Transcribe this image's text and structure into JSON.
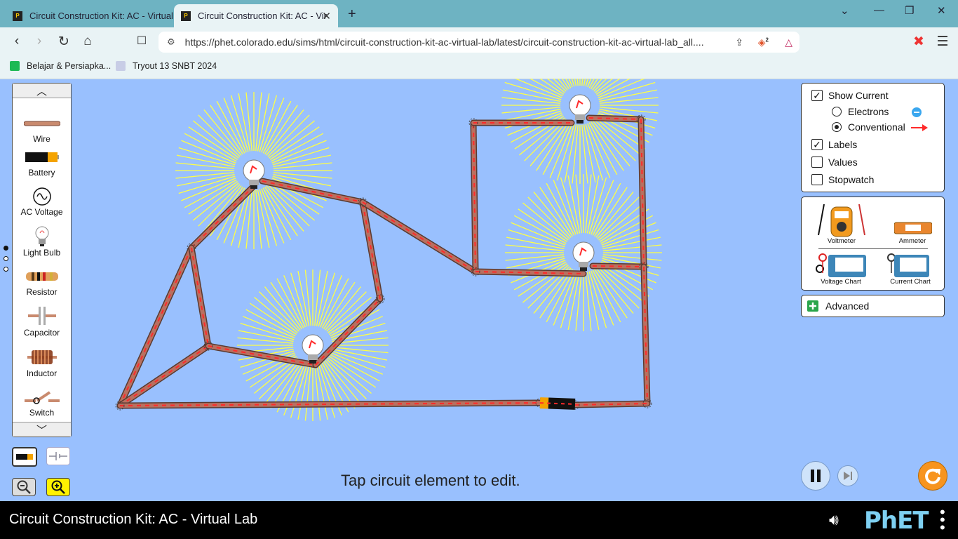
{
  "browser": {
    "tabs": [
      {
        "label": "Circuit Construction Kit: AC - Virtual"
      },
      {
        "label": "Circuit Construction Kit: AC - Vir"
      }
    ],
    "url": "https://phet.colorado.edu/sims/html/circuit-construction-kit-ac-virtual-lab/latest/circuit-construction-kit-ac-virtual-lab_all....",
    "bookmarks": [
      {
        "label": "Belajar & Persiapka..."
      },
      {
        "label": "Tryout 13 SNBT 2024"
      }
    ],
    "brave_badge": "2"
  },
  "toolbox": {
    "items": [
      {
        "label": "Wire",
        "icon": "wire-icon"
      },
      {
        "label": "Battery",
        "icon": "battery-icon"
      },
      {
        "label": "AC Voltage",
        "icon": "ac-voltage-icon"
      },
      {
        "label": "Light Bulb",
        "icon": "light-bulb-icon"
      },
      {
        "label": "Resistor",
        "icon": "resistor-icon"
      },
      {
        "label": "Capacitor",
        "icon": "capacitor-icon"
      },
      {
        "label": "Inductor",
        "icon": "inductor-icon"
      },
      {
        "label": "Switch",
        "icon": "switch-icon"
      }
    ]
  },
  "controls": {
    "show_current": {
      "label": "Show Current",
      "checked": true
    },
    "electrons": {
      "label": "Electrons",
      "selected": false
    },
    "conventional": {
      "label": "Conventional",
      "selected": true
    },
    "labels": {
      "label": "Labels",
      "checked": true
    },
    "values": {
      "label": "Values",
      "checked": false
    },
    "stopwatch": {
      "label": "Stopwatch",
      "checked": false
    }
  },
  "meters": {
    "voltmeter": "Voltmeter",
    "ammeter": "Ammeter",
    "voltage_chart": "Voltage Chart",
    "current_chart": "Current Chart"
  },
  "advanced": {
    "label": "Advanced"
  },
  "hint": "Tap circuit element to edit.",
  "footer": {
    "title": "Circuit Construction Kit: AC - Virtual Lab",
    "logo": "PhET"
  },
  "colors": {
    "canvas": "#99c0fe",
    "wire": "#b87060",
    "current_arrow": "#ff2a2a",
    "rays": "#ffff44",
    "reset": "#f7941e"
  }
}
